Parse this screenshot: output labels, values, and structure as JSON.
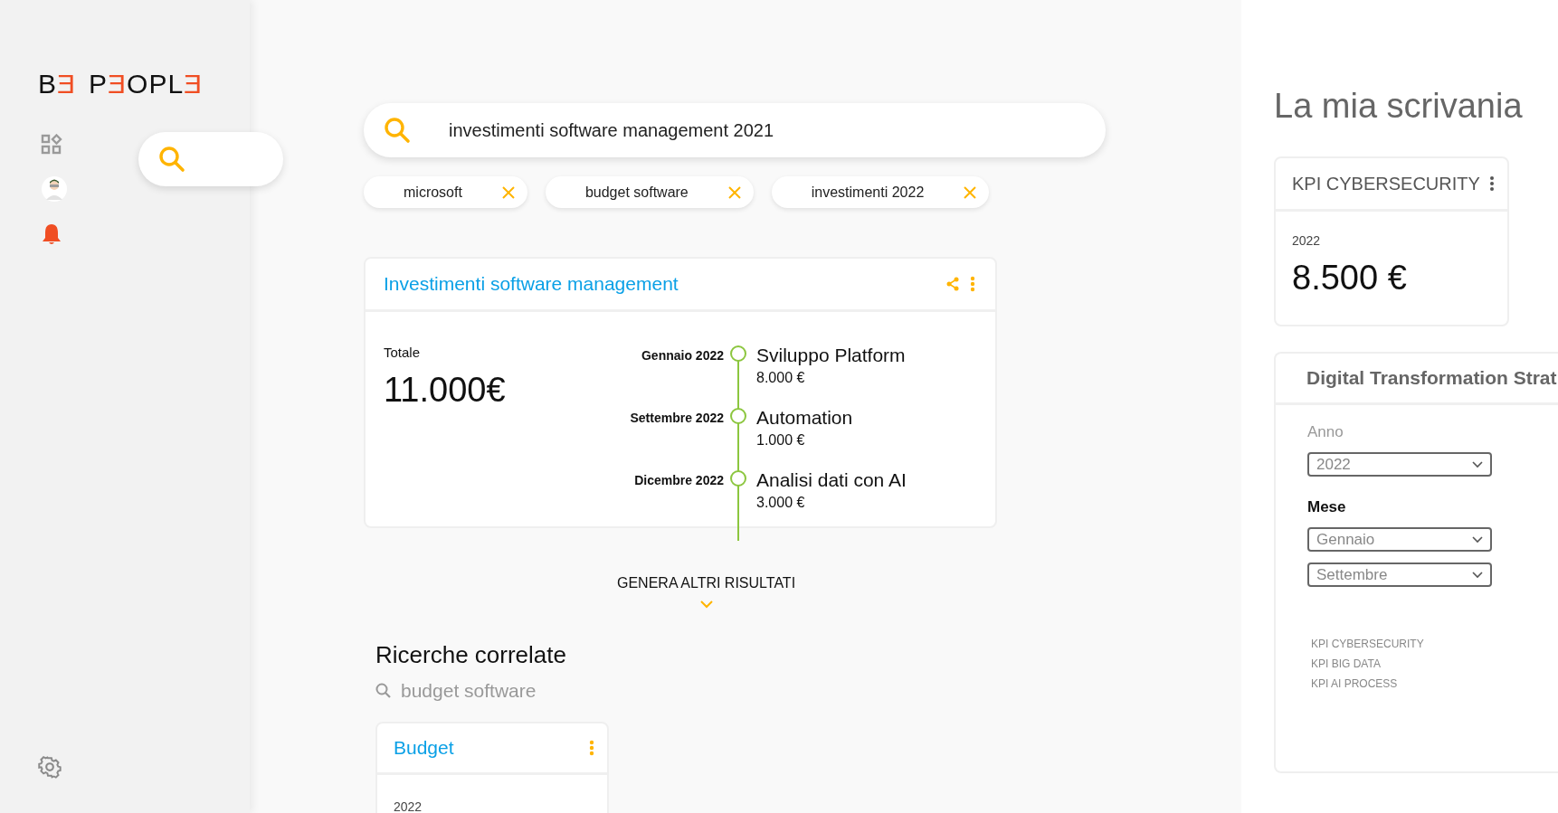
{
  "logo": {
    "words": [
      [
        {
          "text": "B",
          "accent": false
        },
        {
          "text": "Ǝ",
          "accent": true
        }
      ],
      [
        {
          "text": "P",
          "accent": false
        },
        {
          "text": "Ǝ",
          "accent": true
        },
        {
          "text": "O",
          "accent": false
        },
        {
          "text": "P",
          "accent": false
        },
        {
          "text": "L",
          "accent": false
        },
        {
          "text": "Ǝ",
          "accent": true
        }
      ]
    ]
  },
  "search": {
    "value": "investimenti software management 2021"
  },
  "chips": [
    {
      "label": "microsoft"
    },
    {
      "label": "budget software"
    },
    {
      "label": "investimenti 2022"
    }
  ],
  "result_card": {
    "title": "Investimenti software management",
    "total_label": "Totale",
    "total": "11.000€",
    "timeline": [
      {
        "date": "Gennaio 2022",
        "title": "Sviluppo Platform",
        "amount": "8.000 €"
      },
      {
        "date": "Settembre 2022",
        "title": "Automation",
        "amount": "1.000 €"
      },
      {
        "date": "Dicembre 2022",
        "title": "Analisi dati con AI",
        "amount": "3.000 €"
      }
    ]
  },
  "more_button": "GENERA ALTRI RISULTATI",
  "related": {
    "title": "Ricerche correlate",
    "query": "budget software",
    "card": {
      "title": "Budget",
      "year": "2022"
    }
  },
  "desk": {
    "title": "La mia scrivania",
    "kpi_card": {
      "title": "KPI CYBERSECURITY",
      "year": "2022",
      "value": "8.500 €"
    },
    "strategy_card": {
      "title": "Digital Transformation Strat",
      "filters": [
        {
          "label": "Anno",
          "active": false,
          "selects": [
            "2022"
          ]
        },
        {
          "label": "Mese",
          "active": true,
          "selects": [
            "Gennaio",
            "Settembre"
          ]
        }
      ],
      "links": [
        "KPI CYBERSECURITY",
        "KPI BIG DATA",
        "KPI AI PROCESS"
      ]
    }
  }
}
